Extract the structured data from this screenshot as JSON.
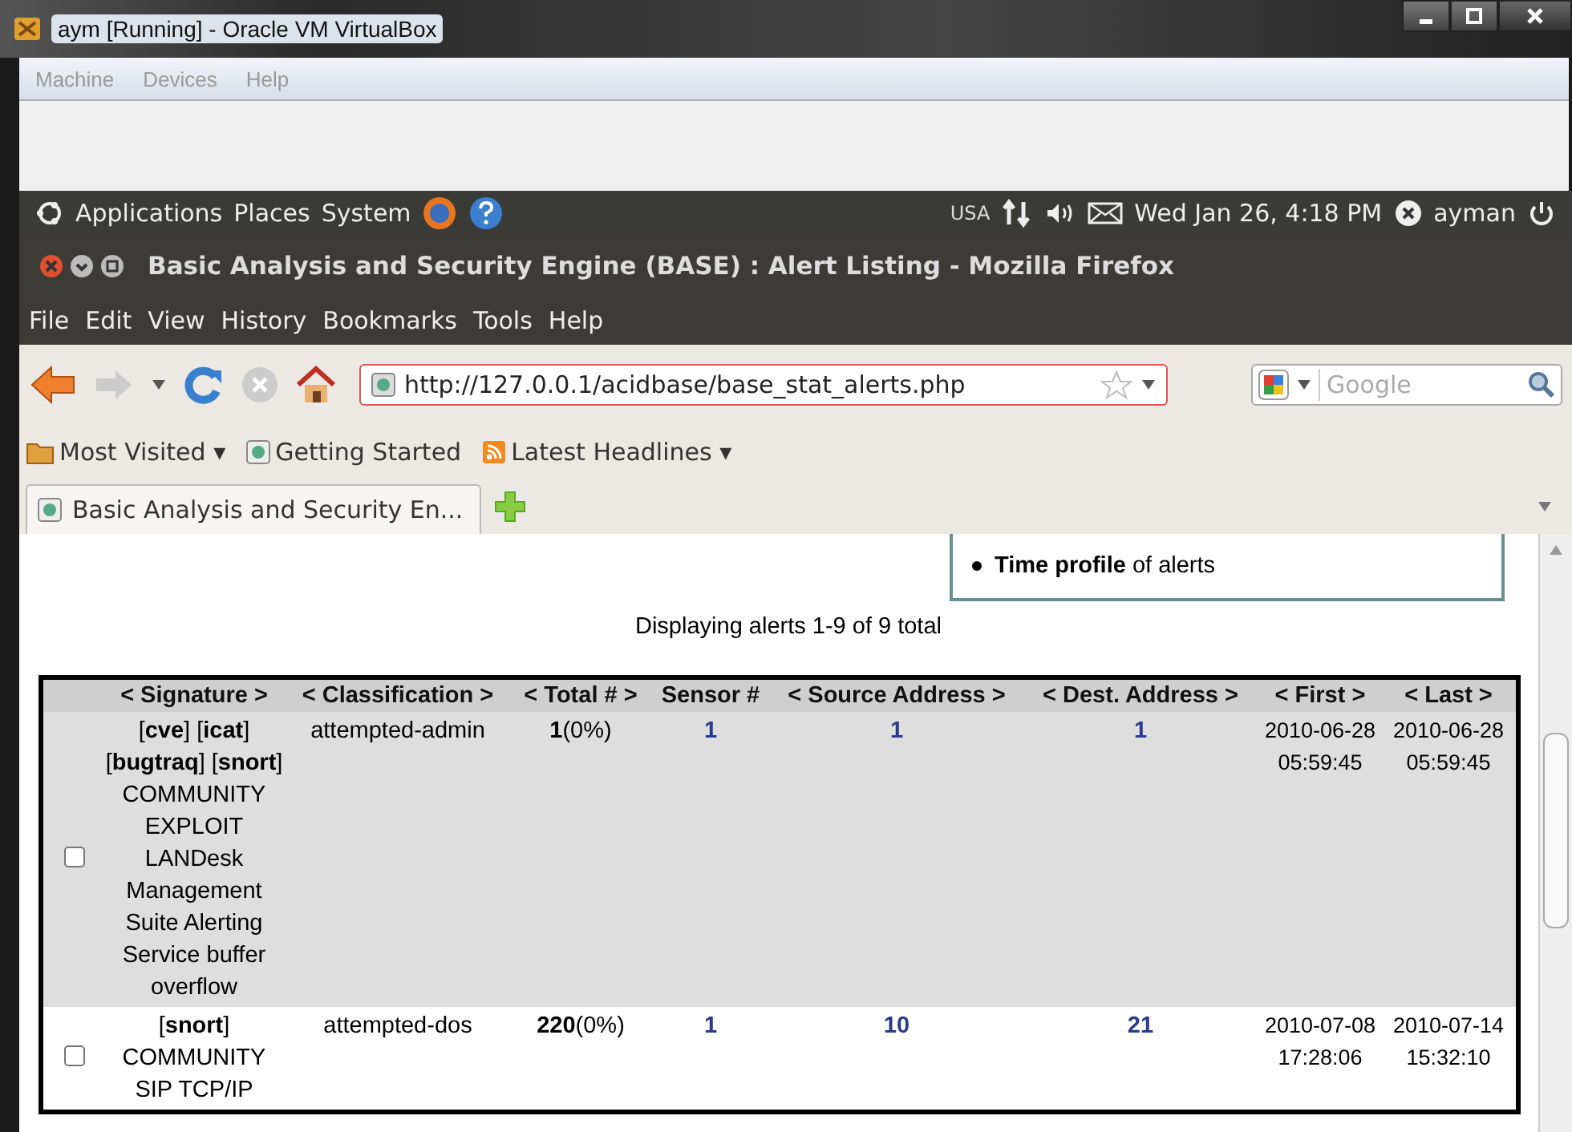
{
  "host_window": {
    "title": "aym [Running] - Oracle VM VirtualBox",
    "menu": [
      "Machine",
      "Devices",
      "Help"
    ]
  },
  "gnome_panel": {
    "menus": [
      "Applications",
      "Places",
      "System"
    ],
    "keyboard": "USA",
    "clock": "Wed Jan 26,  4:18 PM",
    "user": "ayman"
  },
  "browser": {
    "title": "Basic Analysis and Security Engine (BASE) : Alert Listing - Mozilla Firefox",
    "menu": [
      "File",
      "Edit",
      "View",
      "History",
      "Bookmarks",
      "Tools",
      "Help"
    ],
    "url": "http://127.0.0.1/acidbase/base_stat_alerts.php",
    "search": {
      "placeholder": "Google"
    },
    "bookmarks": [
      {
        "label": "Most Visited ▾",
        "kind": "folder"
      },
      {
        "label": "Getting Started",
        "kind": "page"
      },
      {
        "label": "Latest Headlines ▾",
        "kind": "feed"
      }
    ],
    "tabs": [
      {
        "label": "Basic Analysis and Security En...",
        "selected": true
      }
    ]
  },
  "page": {
    "profile_item": "**Time profile** of alerts",
    "summary": "Displaying alerts 1-9 of 9 total",
    "table": {
      "columns": [
        "< Signature >",
        "< Classification >",
        "< Total # >",
        "Sensor #",
        "< Source Address >",
        "< Dest. Address >",
        "< First >",
        "< Last >"
      ],
      "rows": [
        {
          "checked": false,
          "refs": "[**cve**] [**icat**] [**bugtraq**] [**snort**]",
          "signature": "COMMUNITY EXPLOIT LANDesk Management Suite Alerting Service buffer overflow",
          "classification": "attempted-admin",
          "total": "**1**(0%)",
          "sensor": "1",
          "source": "1",
          "dest": "1",
          "first": [
            "2010-06-28",
            "05:59:45"
          ],
          "last": [
            "2010-06-28",
            "05:59:45"
          ]
        },
        {
          "checked": false,
          "refs": "[**snort**]",
          "signature": "COMMUNITY SIP TCP/IP",
          "classification": "attempted-dos",
          "total": "**220**(0%)",
          "sensor": "1",
          "source": "10",
          "dest": "21",
          "first": [
            "2010-07-08",
            "17:28:06"
          ],
          "last": [
            "2010-07-14",
            "15:32:10"
          ]
        }
      ]
    }
  }
}
